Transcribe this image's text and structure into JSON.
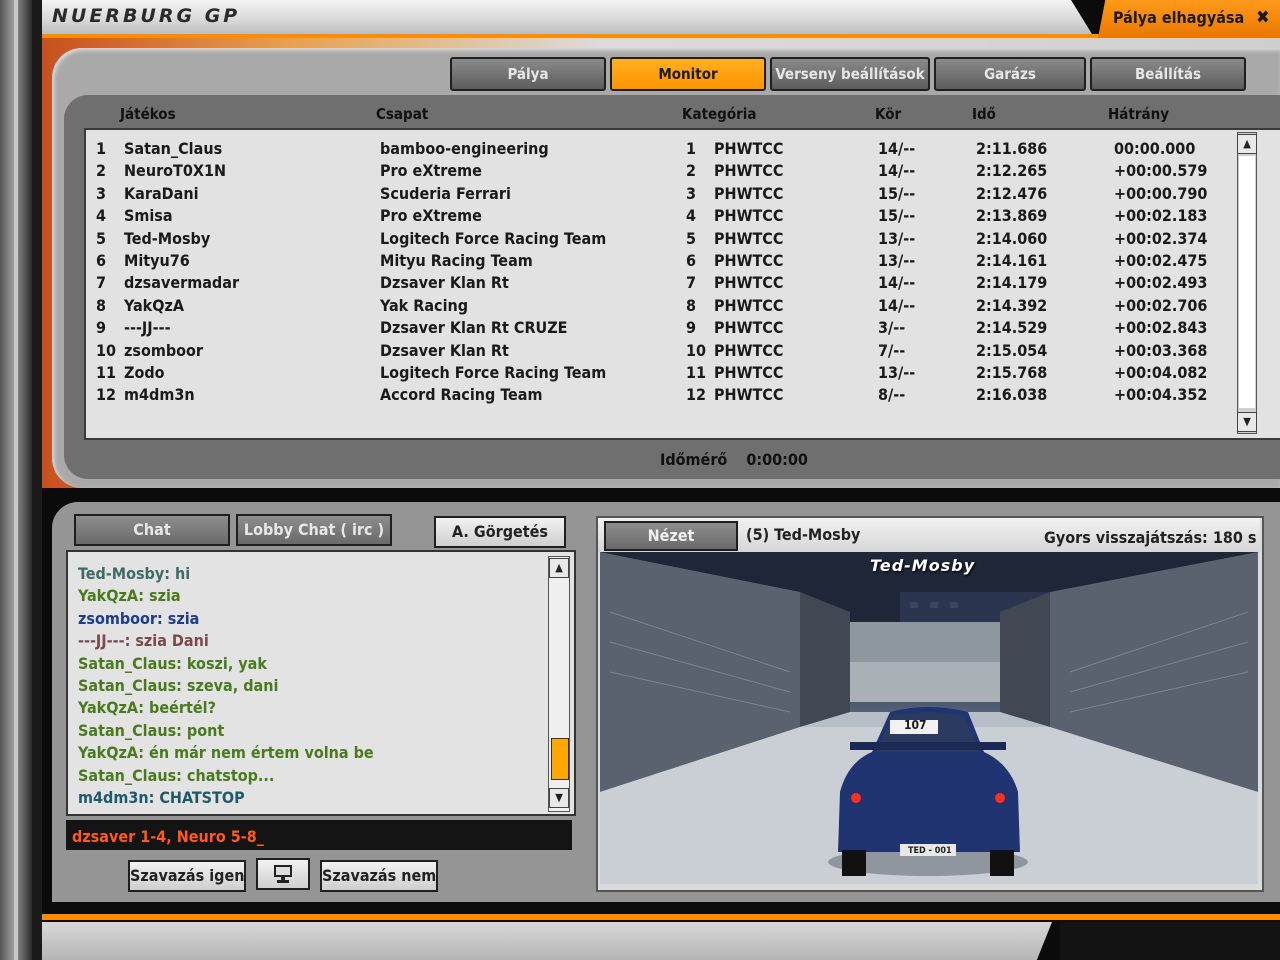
{
  "window": {
    "title": "NUERBURG GP",
    "leave_label": "Pálya elhagyása",
    "leave_icon": "close-x-icon"
  },
  "tabs": [
    {
      "label": "Pálya",
      "active": false
    },
    {
      "label": "Monitor",
      "active": true
    },
    {
      "label": "Verseny beállítások",
      "active": false
    },
    {
      "label": "Garázs",
      "active": false
    },
    {
      "label": "Beállítás",
      "active": false
    }
  ],
  "results": {
    "headers": {
      "player": "Játékos",
      "team": "Csapat",
      "category": "Kategória",
      "lap": "Kör",
      "time": "Idő",
      "gap": "Hátrány"
    },
    "rows": [
      {
        "pos": "1",
        "player": "Satan_Claus",
        "team": "bamboo-engineering",
        "cpos": "1",
        "cat": "PHWTCC",
        "lap": "14/--",
        "time": "2:11.686",
        "gap": "00:00.000"
      },
      {
        "pos": "2",
        "player": "NeuroT0X1N",
        "team": "Pro eXtreme",
        "cpos": "2",
        "cat": "PHWTCC",
        "lap": "14/--",
        "time": "2:12.265",
        "gap": "+00:00.579"
      },
      {
        "pos": "3",
        "player": "KaraDani",
        "team": "Scuderia Ferrari",
        "cpos": "3",
        "cat": "PHWTCC",
        "lap": "15/--",
        "time": "2:12.476",
        "gap": "+00:00.790"
      },
      {
        "pos": "4",
        "player": "Smisa",
        "team": "Pro eXtreme",
        "cpos": "4",
        "cat": "PHWTCC",
        "lap": "15/--",
        "time": "2:13.869",
        "gap": "+00:02.183"
      },
      {
        "pos": "5",
        "player": "Ted-Mosby",
        "team": "Logitech Force Racing Team",
        "cpos": "5",
        "cat": "PHWTCC",
        "lap": "13/--",
        "time": "2:14.060",
        "gap": "+00:02.374"
      },
      {
        "pos": "6",
        "player": "Mityu76",
        "team": "Mityu Racing Team",
        "cpos": "6",
        "cat": "PHWTCC",
        "lap": "13/--",
        "time": "2:14.161",
        "gap": "+00:02.475"
      },
      {
        "pos": "7",
        "player": "dzsavermadar",
        "team": "Dzsaver Klan Rt",
        "cpos": "7",
        "cat": "PHWTCC",
        "lap": "14/--",
        "time": "2:14.179",
        "gap": "+00:02.493"
      },
      {
        "pos": "8",
        "player": "YakQzA",
        "team": "Yak Racing",
        "cpos": "8",
        "cat": "PHWTCC",
        "lap": "14/--",
        "time": "2:14.392",
        "gap": "+00:02.706"
      },
      {
        "pos": "9",
        "player": "---JJ---",
        "team": "Dzsaver Klan Rt CRUZE",
        "cpos": "9",
        "cat": "PHWTCC",
        "lap": "3/--",
        "time": "2:14.529",
        "gap": "+00:02.843"
      },
      {
        "pos": "10",
        "player": "zsomboor",
        "team": "Dzsaver Klan Rt",
        "cpos": "10",
        "cat": "PHWTCC",
        "lap": "7/--",
        "time": "2:15.054",
        "gap": "+00:03.368"
      },
      {
        "pos": "11",
        "player": "Zodo",
        "team": "Logitech Force Racing Team",
        "cpos": "11",
        "cat": "PHWTCC",
        "lap": "13/--",
        "time": "2:15.768",
        "gap": "+00:04.082"
      },
      {
        "pos": "12",
        "player": "m4dm3n",
        "team": "Accord Racing Team",
        "cpos": "12",
        "cat": "PHWTCC",
        "lap": "8/--",
        "time": "2:16.038",
        "gap": "+00:04.352"
      }
    ],
    "timer_label": "Időmérő",
    "timer_value": "0:00:00"
  },
  "chat": {
    "tabs": {
      "chat": "Chat",
      "lobby": "Lobby Chat ( irc )"
    },
    "autoscroll_label": "A. Görgetés",
    "lines": [
      {
        "text": "Ted-Mosby: hi",
        "color": "#3d6b66"
      },
      {
        "text": "YakQzA: szia",
        "color": "#4a7a1e"
      },
      {
        "text": "zsomboor: szia",
        "color": "#1e3c8c"
      },
      {
        "text": "---JJ---: szia Dani",
        "color": "#7a4a4a"
      },
      {
        "text": "Satan_Claus: koszi, yak",
        "color": "#4a7a1e"
      },
      {
        "text": "Satan_Claus: szeva, dani",
        "color": "#4a7a1e"
      },
      {
        "text": "YakQzA: beértél?",
        "color": "#4a7a1e"
      },
      {
        "text": "Satan_Claus: pont",
        "color": "#4a7a1e"
      },
      {
        "text": "YakQzA: én már nem értem volna be",
        "color": "#4a7a1e"
      },
      {
        "text": "Satan_Claus: chatstop...",
        "color": "#4a7a1e"
      },
      {
        "text": "m4dm3n: CHATSTOP",
        "color": "#1e5a6b"
      }
    ],
    "input_value": "dzsaver 1-4, Neuro 5-8_",
    "vote_yes": "Szavazás igen",
    "vote_no": "Szavazás nem",
    "monitor_icon": "computer-monitor-icon"
  },
  "viewer": {
    "view_button": "Nézet",
    "driver_label": "(5) Ted-Mosby",
    "replay_label": "Gyors visszajátszás: 180 s",
    "car_driver": "Ted-Mosby",
    "car_number": "107",
    "plate": "TED - 001"
  },
  "colors": {
    "accent": "#ff8c00",
    "tab_active": "#ffa010",
    "chat_input_text": "#ff5a1a"
  }
}
